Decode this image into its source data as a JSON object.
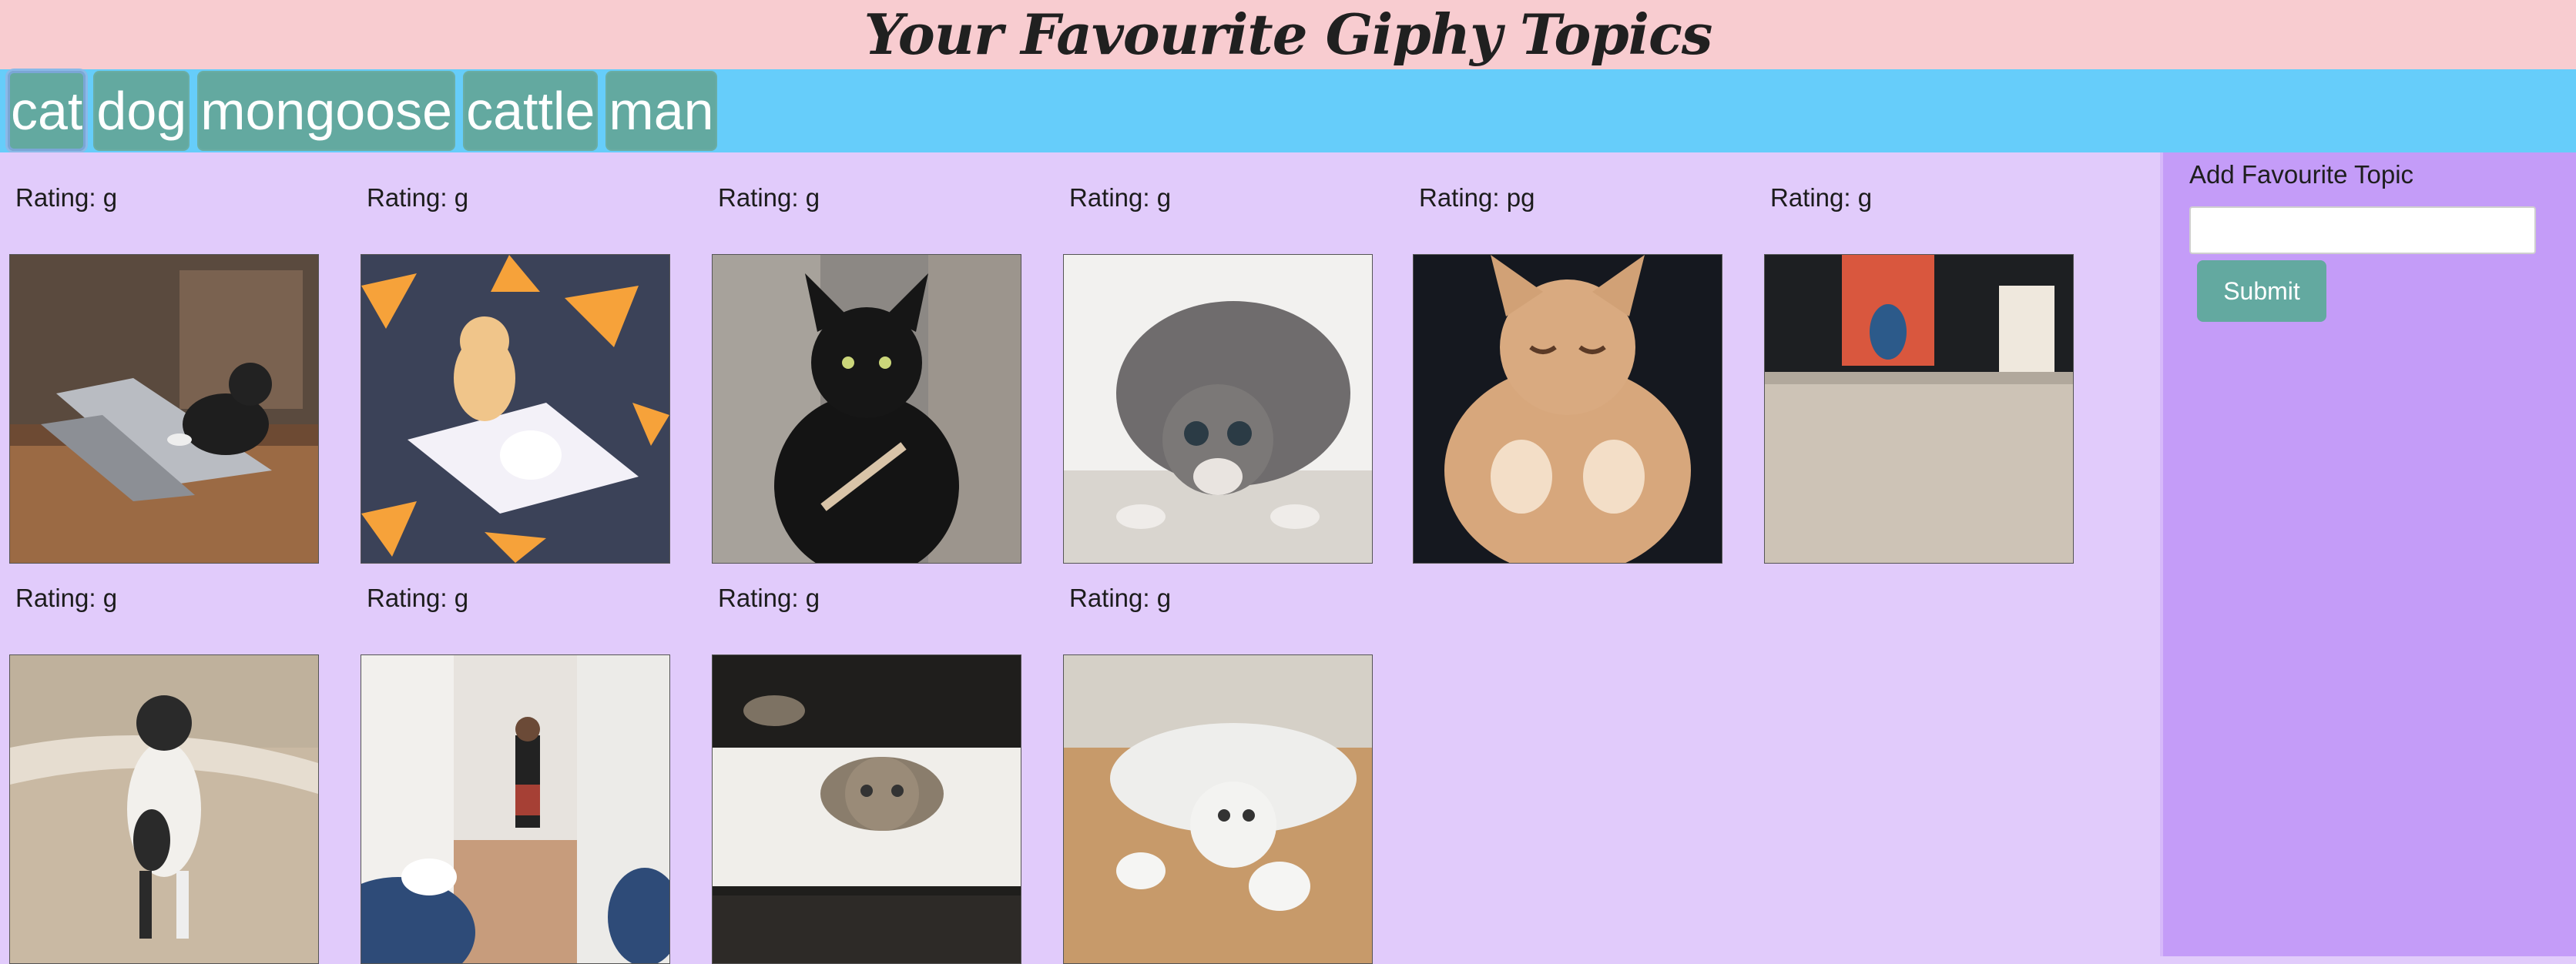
{
  "header": {
    "title": "Your Favourite Giphy Topics"
  },
  "topics": [
    {
      "label": "cat"
    },
    {
      "label": "dog"
    },
    {
      "label": "mongoose"
    },
    {
      "label": "cattle"
    },
    {
      "label": "man"
    }
  ],
  "gifs": [
    {
      "rating": "Rating: g",
      "icon": "cat-laptop-gif"
    },
    {
      "rating": "Rating: g",
      "icon": "cartoon-cat-pizza-gif"
    },
    {
      "rating": "Rating: g",
      "icon": "black-cat-nail-file-gif"
    },
    {
      "rating": "Rating: g",
      "icon": "tabby-cat-crouching-gif"
    },
    {
      "rating": "Rating: pg",
      "icon": "orange-kitten-gif"
    },
    {
      "rating": "Rating: g",
      "icon": "empty-floor-room-gif"
    },
    {
      "rating": "Rating: g",
      "icon": "standing-cat-beach-gif"
    },
    {
      "rating": "Rating: g",
      "icon": "cat-hallway-man-gif"
    },
    {
      "rating": "Rating: g",
      "icon": "tabby-cat-on-bench-gif"
    },
    {
      "rating": "Rating: g",
      "icon": "white-cat-lying-gif"
    }
  ],
  "sidebar": {
    "label": "Add Favourite Topic",
    "input_value": "",
    "submit_label": "Submit"
  },
  "colors": {
    "header_bg": "#f8ccd0",
    "topic_bar_bg": "#66cdfa",
    "button_bg": "#63a9a0",
    "main_bg": "#e1cbfb",
    "sidebar_bg": "#c49cf8"
  }
}
